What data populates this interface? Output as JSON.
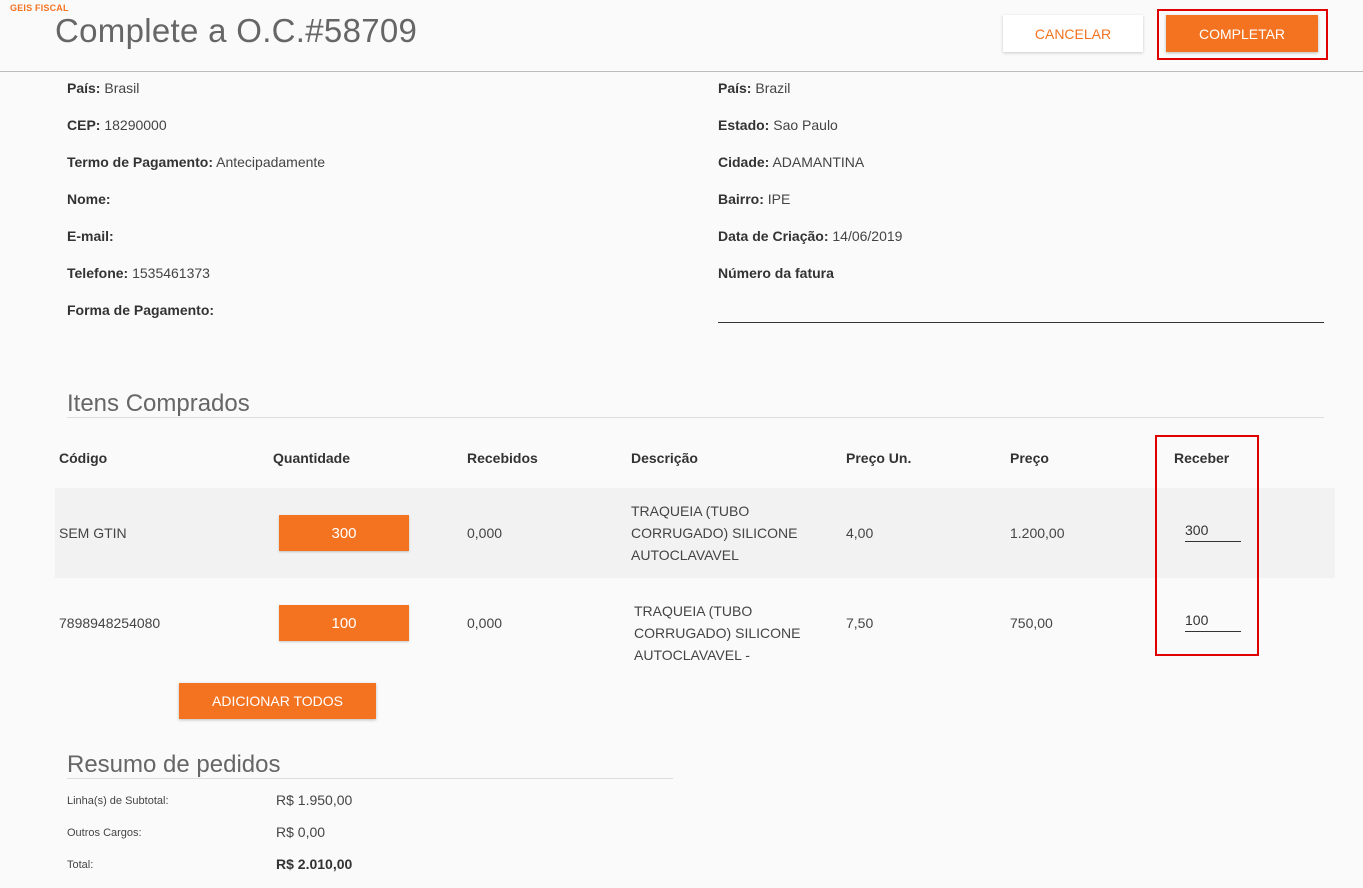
{
  "brand": "GEIS FISCAL",
  "page_title": "Complete a O.C.#58709",
  "actions": {
    "cancel_label": "CANCELAR",
    "complete_label": "COMPLETAR"
  },
  "left_info": [
    {
      "label": "País:",
      "value": "Brasil"
    },
    {
      "label": "CEP:",
      "value": "18290000"
    },
    {
      "label": "Termo de Pagamento:",
      "value": "Antecipadamente"
    },
    {
      "label": "Nome:",
      "value": ""
    },
    {
      "label": "E-mail:",
      "value": ""
    },
    {
      "label": "Telefone:",
      "value": "1535461373"
    },
    {
      "label": "Forma de Pagamento:",
      "value": ""
    }
  ],
  "right_info": [
    {
      "label": "País:",
      "value": "Brazil"
    },
    {
      "label": "Estado:",
      "value": "Sao Paulo"
    },
    {
      "label": "Cidade:",
      "value": "ADAMANTINA"
    },
    {
      "label": "Bairro:",
      "value": "IPE"
    },
    {
      "label": "Data de Criação:",
      "value": "14/06/2019"
    },
    {
      "label": "Número da fatura",
      "value": ""
    }
  ],
  "items_section": {
    "title": "Itens Comprados",
    "columns": [
      "Código",
      "Quantidade",
      "Recebidos",
      "Descrição",
      "Preço Un.",
      "Preço",
      "Receber"
    ],
    "rows": [
      {
        "code": "SEM GTIN",
        "quantity": "300",
        "received": "0,000",
        "description": "TRAQUEIA (TUBO CORRUGADO) SILICONE AUTOCLAVAVEL",
        "unit_price": "4,00",
        "price": "1.200,00",
        "receive": "300"
      },
      {
        "code": "7898948254080",
        "quantity": "100",
        "received": "0,000",
        "description": "TRAQUEIA (TUBO CORRUGADO) SILICONE AUTOCLAVAVEL -",
        "unit_price": "7,50",
        "price": "750,00",
        "receive": "100"
      }
    ],
    "add_all_label": "ADICIONAR TODOS"
  },
  "summary": {
    "title": "Resumo de pedidos",
    "subtotal_label": "Linha(s) de Subtotal:",
    "subtotal_value": "R$ 1.950,00",
    "other_label": "Outros Cargos:",
    "other_value": "R$ 0,00",
    "total_label": "Total:",
    "total_value": "R$ 2.010,00"
  },
  "colors": {
    "accent": "#f47321",
    "highlight": "#e00000"
  }
}
